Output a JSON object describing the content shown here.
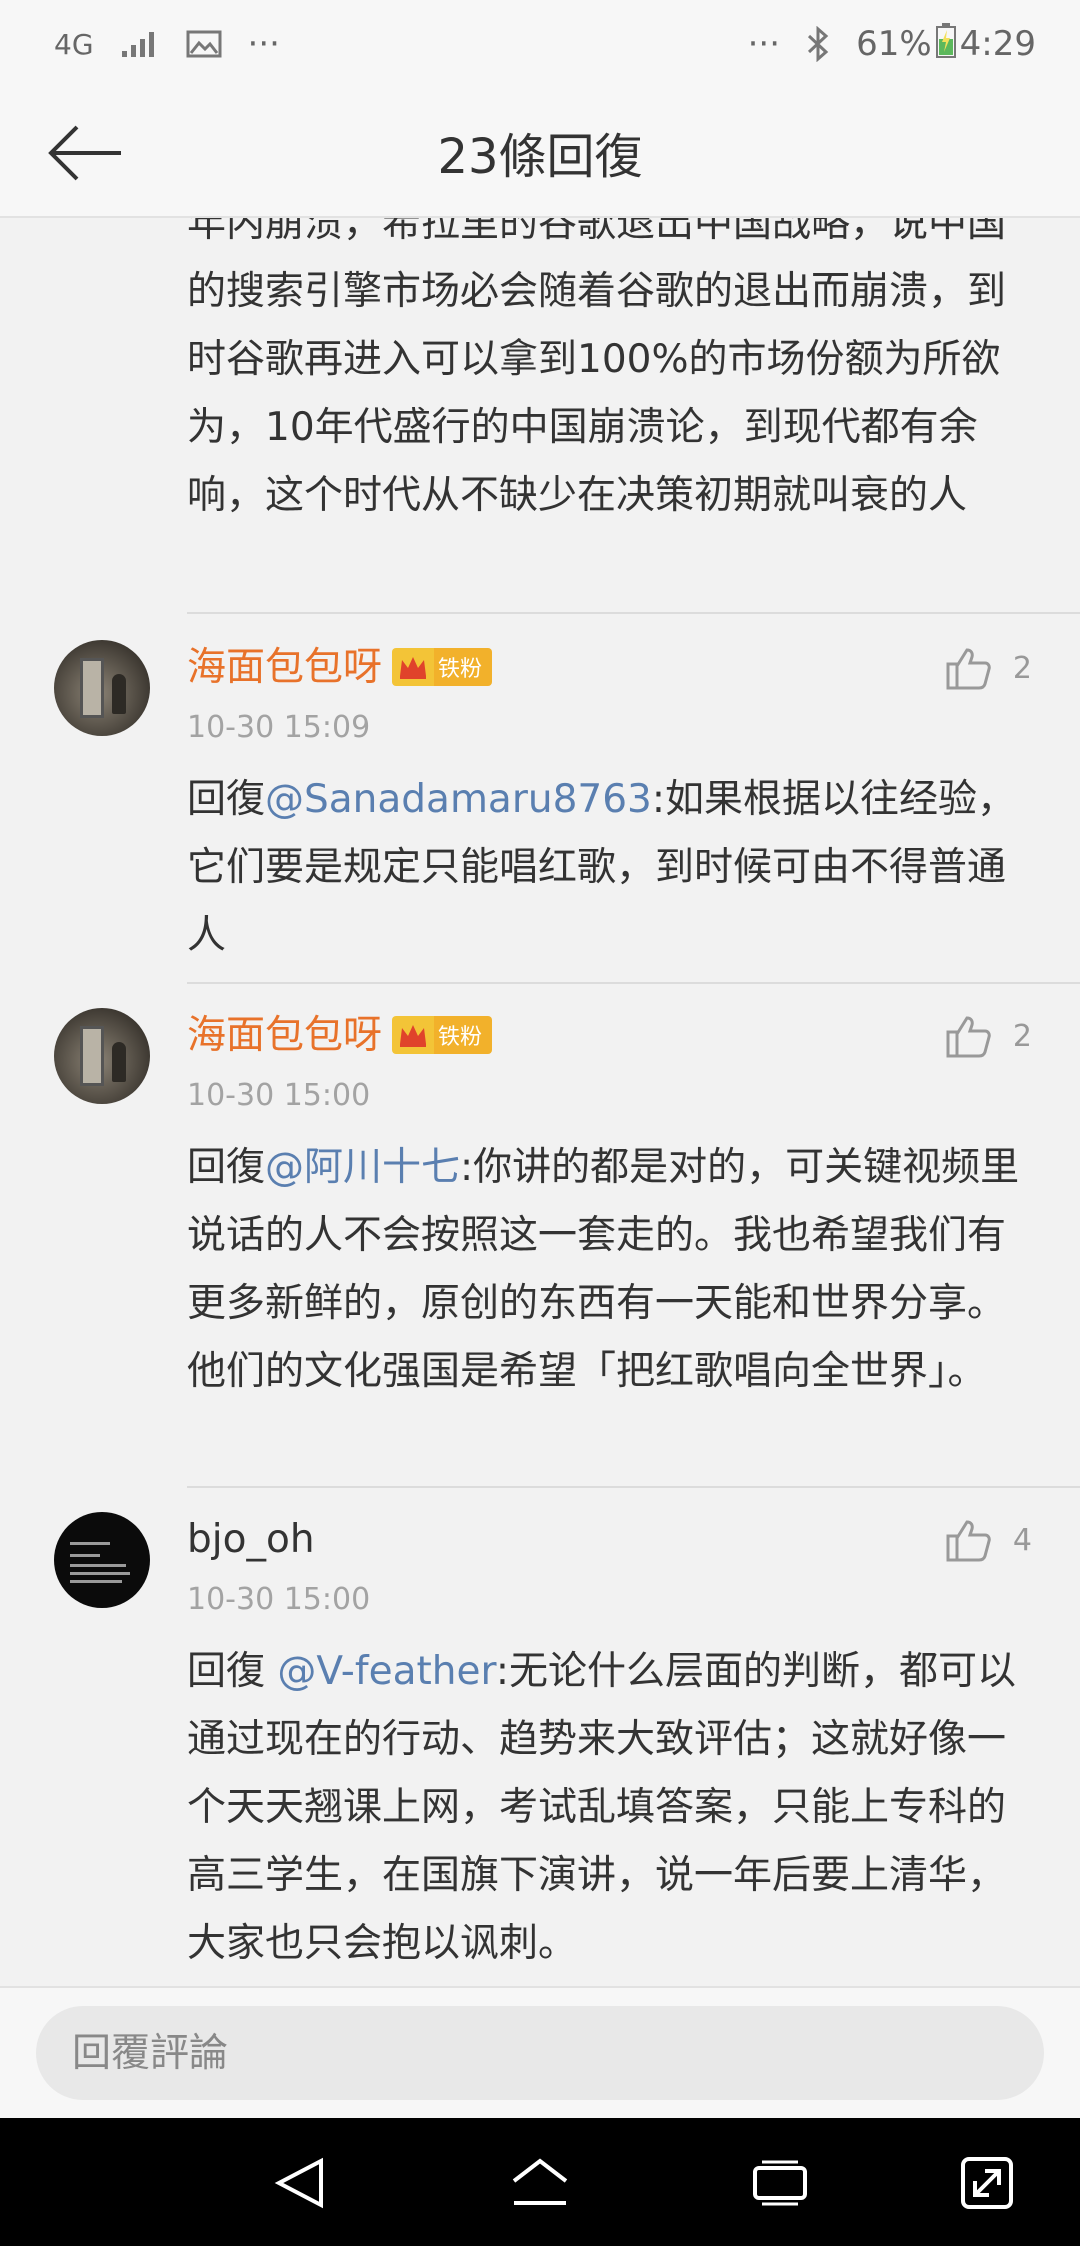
{
  "status_bar": {
    "network": "4G",
    "more_left": "···",
    "more_right": "···",
    "battery": "61%",
    "time": "4:29"
  },
  "header": {
    "title": "23條回復"
  },
  "continuation": {
    "text": "年内崩溃，希拉里的谷歌退出中国战略，说中国的搜索引擎市场必会随着谷歌的退出而崩溃，到时谷歌再进入可以拿到100%的市场份额为所欲为，10年代盛行的中国崩溃论，到现代都有余响，这个时代从不缺少在决策初期就叫衰的人"
  },
  "comments": [
    {
      "username": "海面包包呀",
      "badge": "铁粉",
      "likes": "2",
      "time": "10-30 15:09",
      "reply_prefix": "回復",
      "mention": "@Sanadamaru8763",
      "text": ":如果根据以往经验，它们要是规定只能唱红歌，到时候可由不得普通人"
    },
    {
      "username": "海面包包呀",
      "badge": "铁粉",
      "likes": "2",
      "time": "10-30 15:00",
      "reply_prefix": "回復",
      "mention": "@阿川十七",
      "text": ":你讲的都是对的，可关键视频里说话的人不会按照这一套走的。我也希望我们有更多新鲜的，原创的东西有一天能和世界分享。他们的文化强国是希望「把红歌唱向全世界」。"
    },
    {
      "username": "bjo_oh",
      "likes": "4",
      "time": "10-30 15:00",
      "reply_prefix": "回復 ",
      "mention": "@V-feather",
      "text": ":无论什么层面的判断，都可以通过现在的行动、趋势来大致评估；这就好像一个天天翘课上网，考试乱填答案，只能上专科的高三学生，在国旗下演讲，说一年后要上清华，大家也只会抱以讽刺。"
    }
  ],
  "reply_bar": {
    "placeholder": "回覆評論"
  },
  "colors": {
    "username_orange": "#e8722a",
    "mention_blue": "#5a7fb0",
    "badge_gold": "#f2b12b"
  }
}
